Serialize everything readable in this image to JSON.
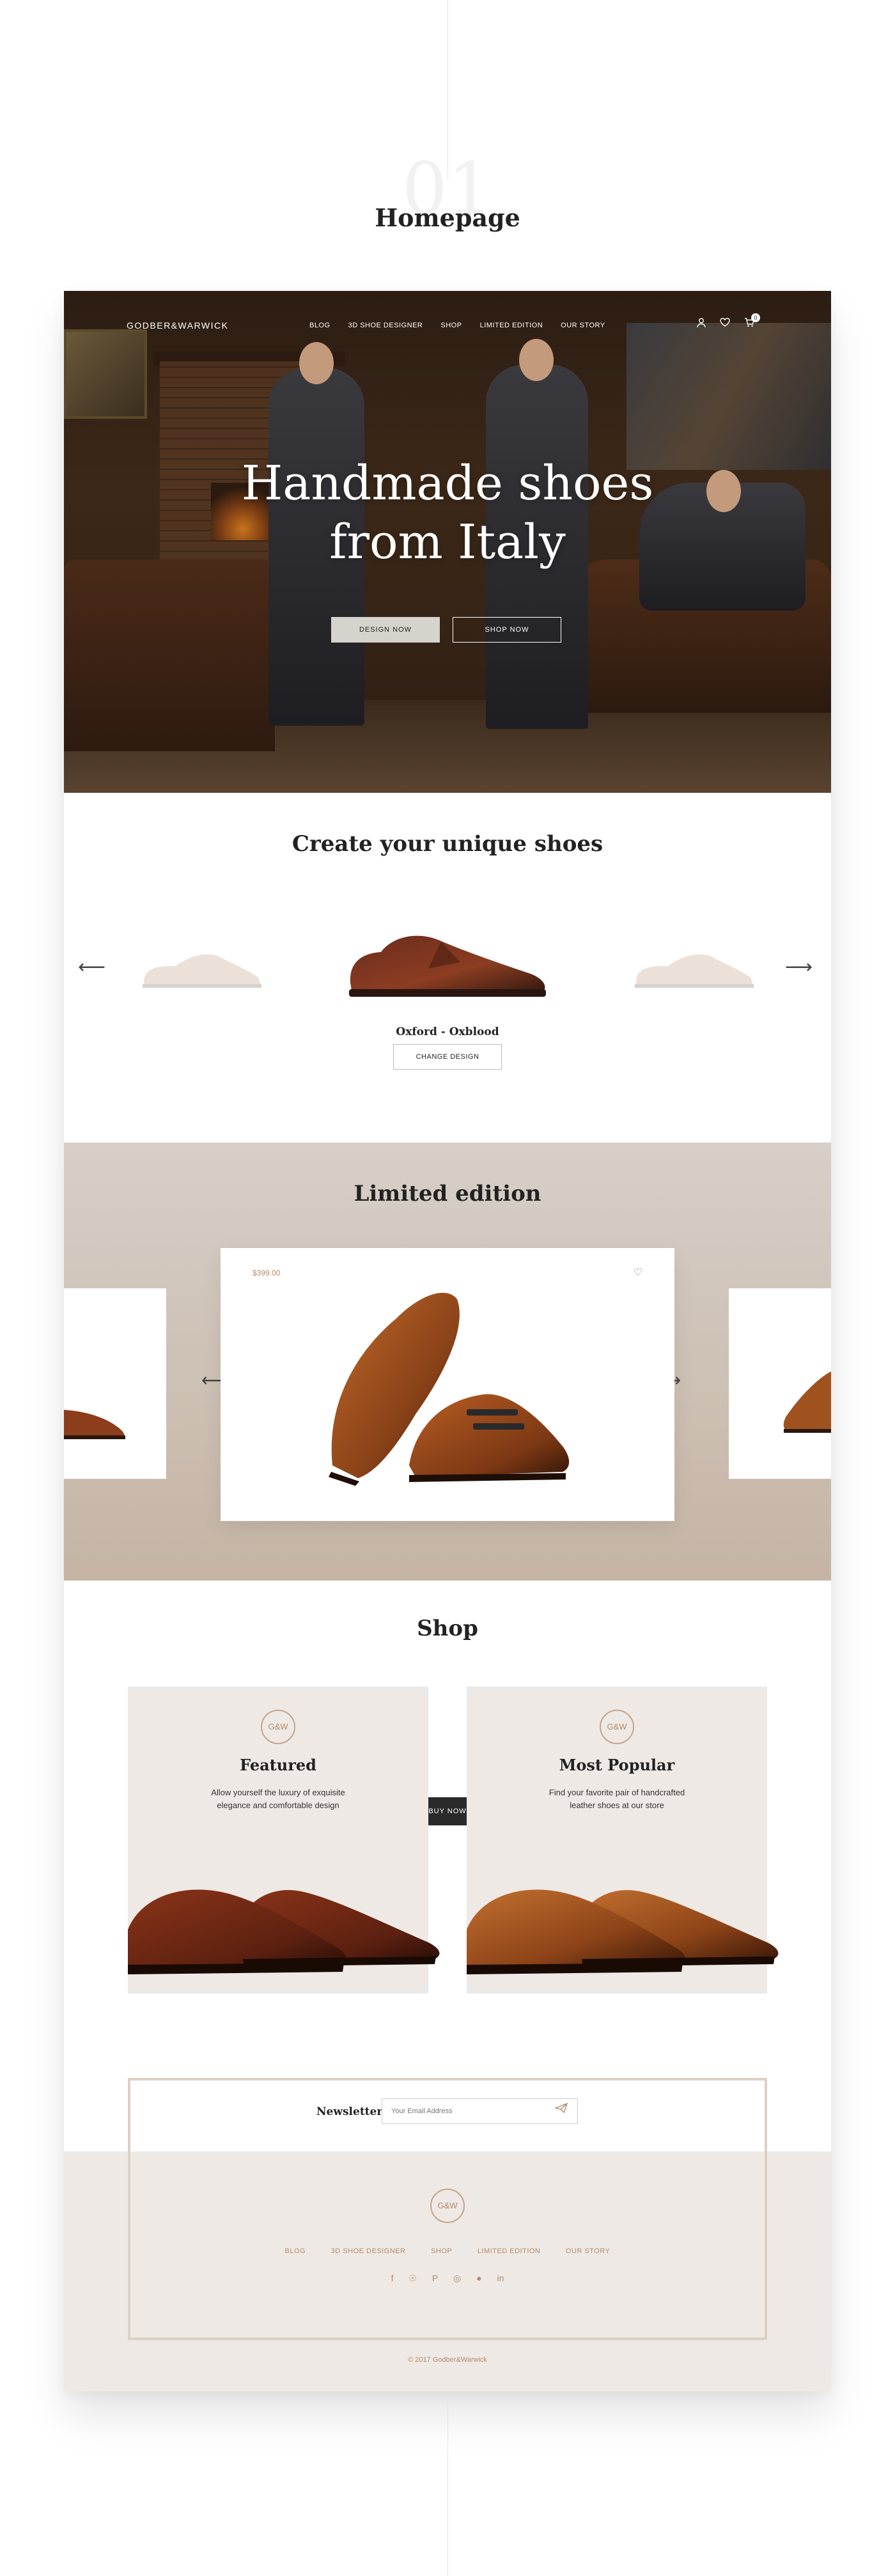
{
  "page": {
    "number": "01",
    "label": "Homepage"
  },
  "nav": {
    "logo": "GODBER&WARWICK",
    "items": [
      "BLOG",
      "3D SHOE DESIGNER",
      "SHOP",
      "LIMITED EDITION",
      "OUR STORY"
    ],
    "icons": [
      "user-icon",
      "heart-icon",
      "cart-icon"
    ],
    "cart_count": "0"
  },
  "hero": {
    "title_line1": "Handmade shoes",
    "title_line2": "from Italy",
    "design_button": "DESIGN NOW",
    "shop_button": "SHOP NOW"
  },
  "create": {
    "title": "Create your unique shoes",
    "shoe_name": "Oxford - Oxblood",
    "change_button": "CHANGE DESIGN"
  },
  "limited": {
    "title": "Limited edition",
    "price": "$399.00",
    "buy_button": "BUY NOW"
  },
  "shop": {
    "title": "Shop",
    "cards": [
      {
        "logo": "G&W",
        "title": "Featured",
        "desc_line1": "Allow yourself the luxury of exquisite",
        "desc_line2": "elegance and comfortable design"
      },
      {
        "logo": "G&W",
        "title": "Most Popular",
        "desc_line1": "Find your favorite pair of handcrafted",
        "desc_line2": "leather shoes at our store"
      }
    ]
  },
  "footer": {
    "newsletter_label": "Newsletter",
    "email_placeholder": "Your Email Address",
    "logo": "G&W",
    "menu": [
      "BLOG",
      "3D SHOE DESIGNER",
      "SHOP",
      "LIMITED EDITION",
      "OUR STORY"
    ],
    "social": [
      "facebook-icon",
      "weibo-icon",
      "pinterest-icon",
      "instagram-icon",
      "wechat-icon",
      "linkedin-icon"
    ],
    "copyright": "© 2017 Godber&Warwick"
  },
  "colors": {
    "accent": "#b08a6a",
    "dark": "#2a2a2a",
    "panel": "#efe9e5"
  }
}
